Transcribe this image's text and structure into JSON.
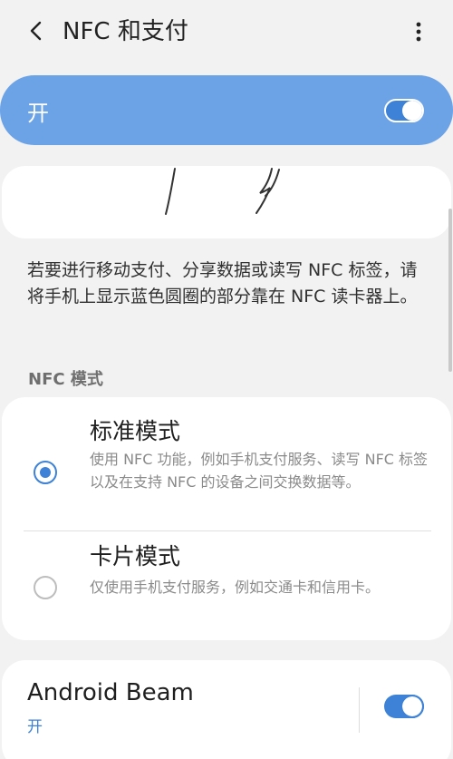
{
  "header": {
    "title": "NFC 和支付",
    "back_icon": "back-arrow-icon",
    "more_icon": "more-vert-icon"
  },
  "master_switch": {
    "label": "开",
    "state": "on"
  },
  "description": "若要进行移动支付、分享数据或读写 NFC 标签，请将手机上显示蓝色圆圈的部分靠在 NFC 读卡器上。",
  "nfc_mode": {
    "section_title": "NFC 模式",
    "options": [
      {
        "title": "标准模式",
        "subtitle": "使用 NFC 功能，例如手机支付服务、读写 NFC 标签以及在支持 NFC 的设备之间交换数据等。",
        "selected": true
      },
      {
        "title": "卡片模式",
        "subtitle": "仅使用手机支付服务，例如交通卡和信用卡。",
        "selected": false
      }
    ]
  },
  "android_beam": {
    "title": "Android Beam",
    "status": "开",
    "state": "on"
  },
  "colors": {
    "accent": "#3d82d6",
    "master_bar": "#6ca3e6",
    "background": "#f2f2f2"
  }
}
